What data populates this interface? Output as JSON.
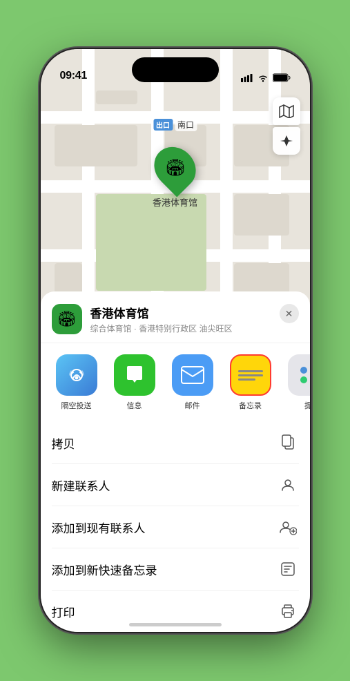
{
  "status_bar": {
    "time": "09:41",
    "time_icon": "▶"
  },
  "map": {
    "label_tag": "出口",
    "label_text": "南口",
    "venue_pin_emoji": "🏟",
    "pin_label": "香港体育馆"
  },
  "map_controls": {
    "map_btn_label": "🗺",
    "location_btn_label": "➤"
  },
  "venue_header": {
    "icon_emoji": "🏟",
    "name": "香港体育馆",
    "desc": "综合体育馆 · 香港特别行政区 油尖旺区",
    "close_label": "✕"
  },
  "share_items": [
    {
      "id": "airdrop",
      "label": "隔空投送",
      "type": "airdrop"
    },
    {
      "id": "message",
      "label": "信息",
      "type": "message"
    },
    {
      "id": "mail",
      "label": "邮件",
      "type": "mail"
    },
    {
      "id": "notes",
      "label": "备忘录",
      "type": "notes"
    },
    {
      "id": "more",
      "label": "提",
      "type": "more"
    }
  ],
  "action_items": [
    {
      "id": "copy",
      "label": "拷贝",
      "icon": "copy"
    },
    {
      "id": "new-contact",
      "label": "新建联系人",
      "icon": "person"
    },
    {
      "id": "add-contact",
      "label": "添加到现有联系人",
      "icon": "person-add"
    },
    {
      "id": "quick-note",
      "label": "添加到新快速备忘录",
      "icon": "note"
    },
    {
      "id": "print",
      "label": "打印",
      "icon": "print"
    }
  ]
}
